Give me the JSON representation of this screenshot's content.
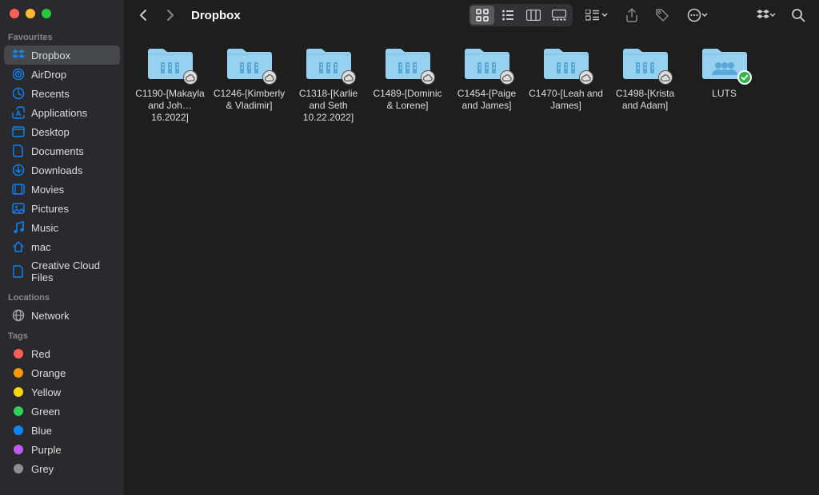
{
  "window": {
    "title": "Dropbox"
  },
  "sidebar": {
    "sections": [
      {
        "header": "Favourites",
        "items": [
          {
            "label": "Dropbox",
            "icon": "dropbox-icon",
            "active": true
          },
          {
            "label": "AirDrop",
            "icon": "airdrop-icon"
          },
          {
            "label": "Recents",
            "icon": "clock-icon"
          },
          {
            "label": "Applications",
            "icon": "apps-icon"
          },
          {
            "label": "Desktop",
            "icon": "desktop-icon"
          },
          {
            "label": "Documents",
            "icon": "document-icon"
          },
          {
            "label": "Downloads",
            "icon": "download-icon"
          },
          {
            "label": "Movies",
            "icon": "movies-icon"
          },
          {
            "label": "Pictures",
            "icon": "pictures-icon"
          },
          {
            "label": "Music",
            "icon": "music-icon"
          },
          {
            "label": "mac",
            "icon": "home-icon"
          },
          {
            "label": "Creative Cloud Files",
            "icon": "cc-file-icon"
          }
        ]
      },
      {
        "header": "Locations",
        "items": [
          {
            "label": "Network",
            "icon": "network-icon"
          }
        ]
      },
      {
        "header": "Tags",
        "items": [
          {
            "label": "Red",
            "color": "#ff5f57"
          },
          {
            "label": "Orange",
            "color": "#fd9a00"
          },
          {
            "label": "Yellow",
            "color": "#ffd60a"
          },
          {
            "label": "Green",
            "color": "#30d158"
          },
          {
            "label": "Blue",
            "color": "#0a84ff"
          },
          {
            "label": "Purple",
            "color": "#bf5af2"
          },
          {
            "label": "Grey",
            "color": "#8e8e93"
          }
        ]
      }
    ]
  },
  "folders": [
    {
      "name": "C1190-[Makayla and Joh…16.2022]",
      "badge": "cloud"
    },
    {
      "name": "C1246-[Kimberly & Vladimir]",
      "badge": "cloud"
    },
    {
      "name": "C1318-[Karlie and Seth 10.22.2022]",
      "badge": "cloud"
    },
    {
      "name": "C1489-[Dominic & Lorene]",
      "badge": "cloud"
    },
    {
      "name": "C1454-[Paige and James]",
      "badge": "cloud"
    },
    {
      "name": "C1470-[Leah and James]",
      "badge": "cloud"
    },
    {
      "name": "C1498-[Krista and Adam]",
      "badge": "cloud"
    },
    {
      "name": "LUTS",
      "badge": "check",
      "icon": "shared"
    }
  ]
}
